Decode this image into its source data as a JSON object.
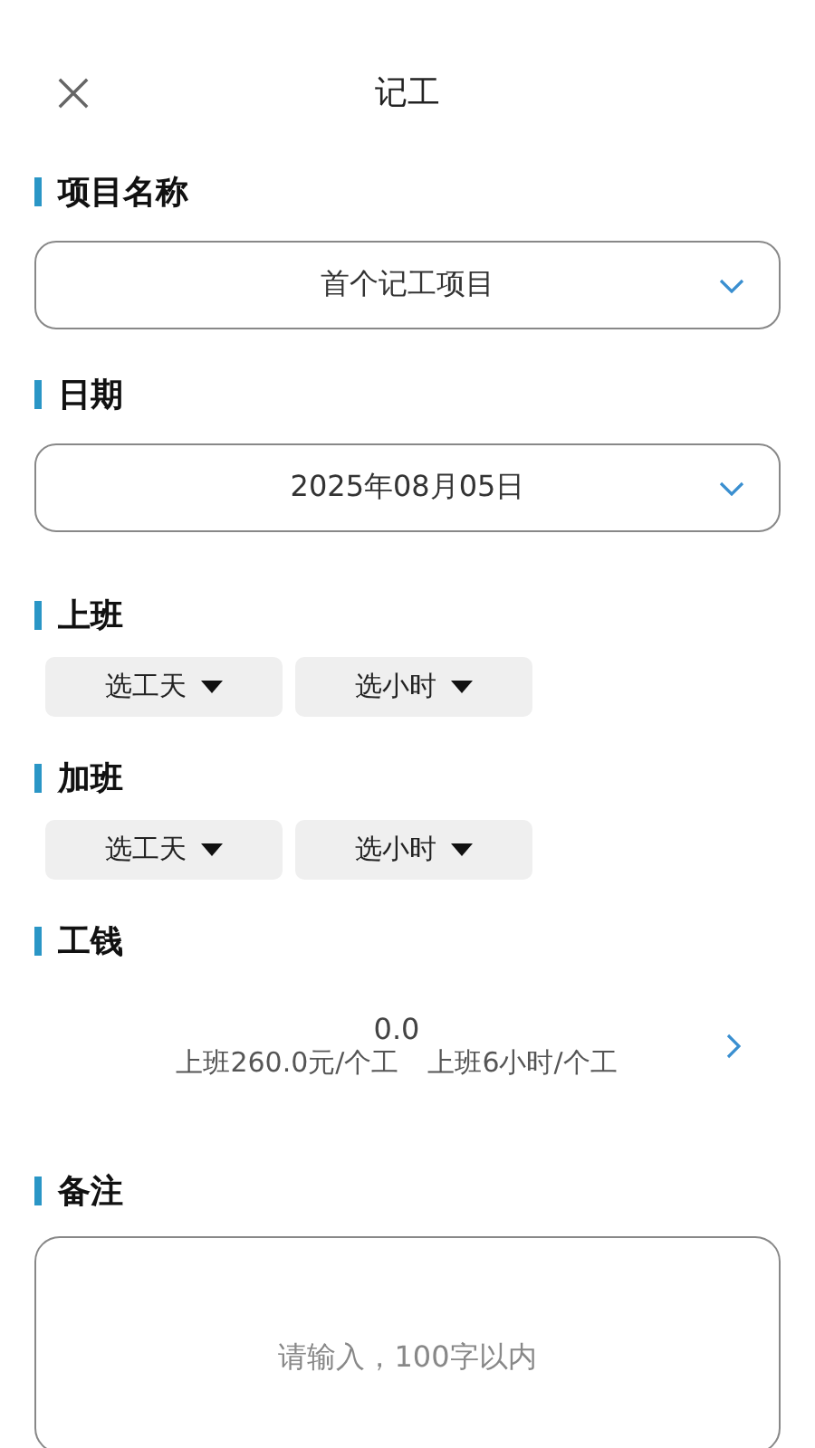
{
  "header": {
    "title": "记工"
  },
  "sections": [
    {
      "kind": "select",
      "title": "项目名称",
      "value": "首个记工项目"
    },
    {
      "kind": "select",
      "title": "日期",
      "value": "2025年08月05日"
    },
    {
      "kind": "pickers",
      "title": "上班",
      "pickers": [
        "选工天",
        "选小时"
      ]
    },
    {
      "kind": "pickers",
      "title": "加班",
      "pickers": [
        "选工天",
        "选小时"
      ]
    },
    {
      "kind": "wage",
      "title": "工钱",
      "amount": "0.0",
      "rates": [
        "上班260.0元/个工",
        "上班6小时/个工"
      ]
    },
    {
      "kind": "note",
      "title": "备注",
      "placeholder": "请输入，100字以内"
    }
  ]
}
